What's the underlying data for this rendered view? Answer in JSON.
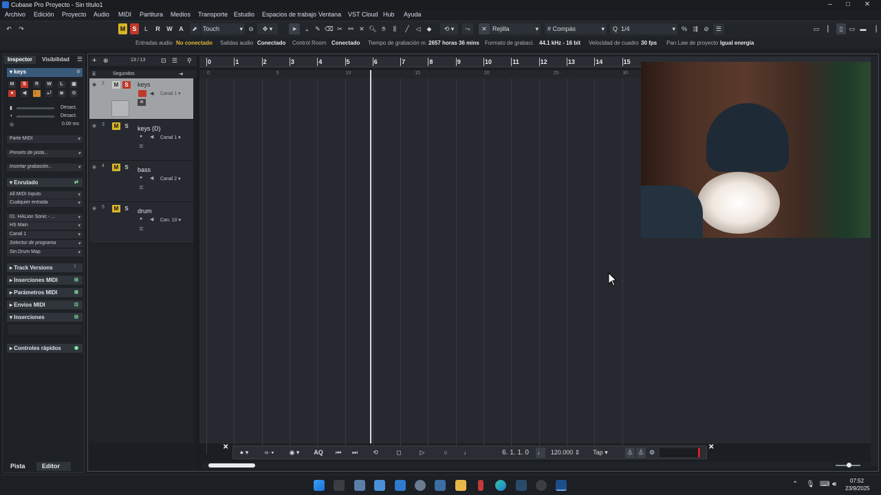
{
  "window": {
    "title": "Cubase Pro Proyecto - Sin título1",
    "controls": [
      "–",
      "□",
      "✕"
    ]
  },
  "menu": [
    "Archivo",
    "Edición",
    "Proyecto",
    "Audio",
    "MIDI",
    "Partitura",
    "Medios",
    "Transporte",
    "Estudio",
    "Espacios de trabajo",
    "Ventana",
    "VST Cloud",
    "Hub",
    "Ayuda"
  ],
  "toolbar": {
    "mode_buttons": [
      "M",
      "S",
      "L",
      "R",
      "W",
      "A"
    ],
    "automation_mode": "Touch",
    "snap_type": "Rejilla",
    "grid_type": "Compás",
    "quantize": "1/4"
  },
  "status": {
    "audio_inputs_label": "Entradas audio",
    "audio_inputs_value": "No conectado",
    "audio_outputs_label": "Salidas audio",
    "audio_outputs_value": "Conectado",
    "control_room_label": "Control Room",
    "control_room_value": "Conectado",
    "rec_time_label": "Tiempo de grabación m.",
    "rec_time_value": "2657 horas 36 mins",
    "rec_format_label": "Formato de grabaci.",
    "rec_format_value": "44.1 kHz - 16 bit",
    "frame_rate_label": "Velocidad de cuadro",
    "frame_rate_value": "30 fps",
    "pan_law_label": "Pan Law de proyecto",
    "pan_law_value": "Igual energía"
  },
  "inspector": {
    "tabs": [
      "Inspector",
      "Visibilidad"
    ],
    "track_name": "keys",
    "buttons_row1": [
      "M",
      "S",
      "R",
      "W",
      "L"
    ],
    "volume_value": "Desact.",
    "pan_value": "Desact.",
    "delay_value": "0.00 ms",
    "midi_part": "Parte MIDI",
    "track_presets": "Presets de pista...",
    "insert_recording": "Insertar grabación...",
    "routing_section": "Enrutado",
    "midi_input": "All MIDI Inputs",
    "input_any": "Cualquier entrada",
    "instrument": "01. HALion Sonic - ...",
    "output": "HS Main",
    "channel": "Canal 1",
    "program_selector": "Selector de programa",
    "drum_map": "Sin Drum Map",
    "sections": [
      "Track Versions",
      "Inserciones MIDI",
      "Parámetros MIDI",
      "Envíos MIDI",
      "Inserciones",
      "Controles rápidos"
    ],
    "bottom_tabs": [
      "Pista",
      "Editor"
    ]
  },
  "tracklist": {
    "counter": "13 / 13",
    "time_format": "Segundos",
    "tracks": [
      {
        "num": "2",
        "name": "keys",
        "channel": "Canal 1"
      },
      {
        "num": "3",
        "name": "keys (D)",
        "channel": "Canal 1"
      },
      {
        "num": "4",
        "name": "bass",
        "channel": "Canal 2"
      },
      {
        "num": "5",
        "name": "drum",
        "channel": "Can. 10"
      }
    ]
  },
  "ruler": {
    "bars": [
      "0",
      "1",
      "2",
      "3",
      "4",
      "5",
      "6",
      "7",
      "8",
      "9",
      "10",
      "11",
      "12",
      "13",
      "14",
      "15"
    ],
    "seconds": [
      "0",
      "5",
      "10",
      "15",
      "20",
      "25",
      "30"
    ]
  },
  "transport": {
    "aq": "AQ",
    "position": "6. 1. 1.   0",
    "tempo": "120.000",
    "tap": "Tap"
  },
  "clock": {
    "time": "07:52",
    "date": "23/9/2025"
  }
}
